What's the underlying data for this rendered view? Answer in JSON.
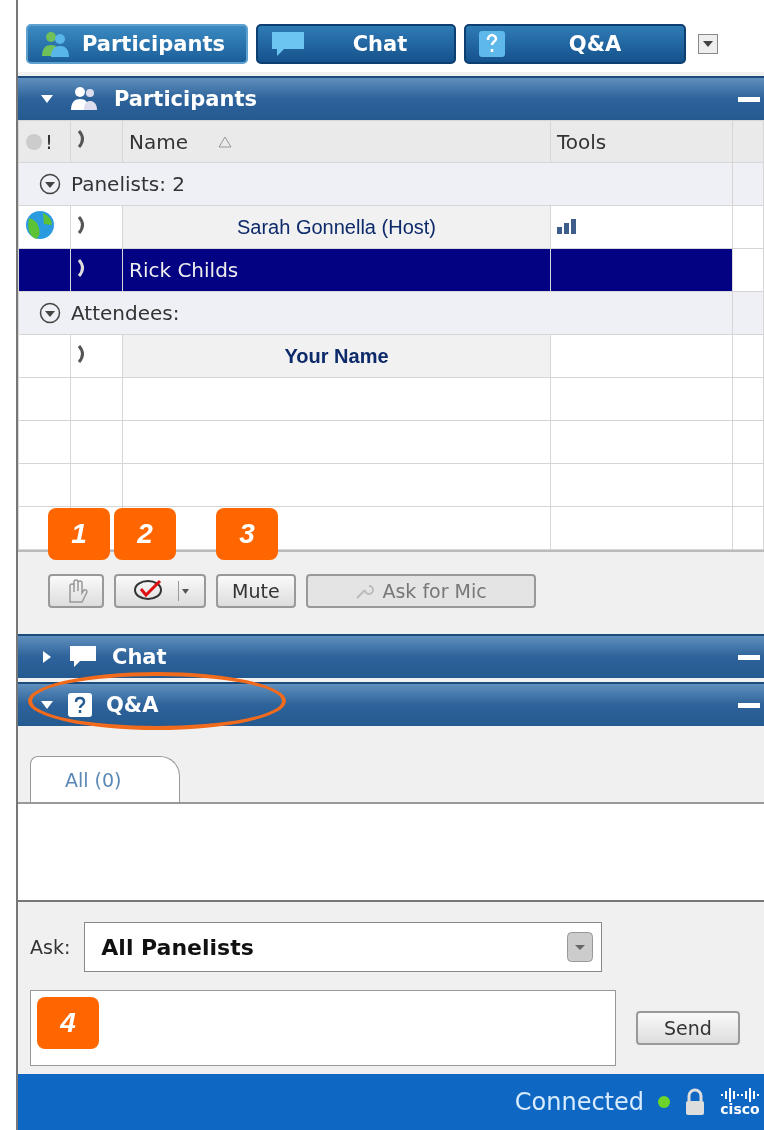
{
  "tabs": [
    {
      "label": "Participants",
      "selected": true
    },
    {
      "label": "Chat",
      "selected": false
    },
    {
      "label": "Q&A",
      "selected": false
    }
  ],
  "participants_panel": {
    "title": "Participants",
    "expanded": true,
    "columns": [
      "!",
      "Name",
      "Tools"
    ],
    "groups": [
      {
        "label": "Panelists: 2",
        "expanded": true,
        "rows": [
          {
            "name": "Sarah Gonnella (Host)",
            "kind": "boxed",
            "selected": false,
            "presenter": true,
            "tools": true
          },
          {
            "name": "Rick Childs",
            "kind": "plain",
            "selected": true,
            "presenter": false,
            "tools": false
          }
        ]
      },
      {
        "label": "Attendees:",
        "expanded": true,
        "rows": [
          {
            "name": "Your Name",
            "kind": "boxed-bold",
            "selected": false,
            "presenter": false,
            "tools": false
          }
        ]
      }
    ],
    "toolbar": [
      {
        "kind": "hand",
        "callout": "1",
        "disabled": false
      },
      {
        "kind": "feedback",
        "callout": "2",
        "disabled": false
      },
      {
        "kind": "text",
        "label": "Mute",
        "callout": "3",
        "disabled": false
      },
      {
        "kind": "mic",
        "label": "Ask for Mic",
        "disabled": true
      }
    ]
  },
  "chat_panel": {
    "title": "Chat",
    "expanded": false
  },
  "qa_panel": {
    "title": "Q&A",
    "expanded": true,
    "highlighted": true,
    "tabs": [
      {
        "label": "All (0)",
        "selected": true
      }
    ],
    "ask_label": "Ask:",
    "ask_value": "All Panelists",
    "message_callout": "4",
    "send": "Send"
  },
  "status_bar": {
    "status": "Connected",
    "logo": "cisco"
  }
}
